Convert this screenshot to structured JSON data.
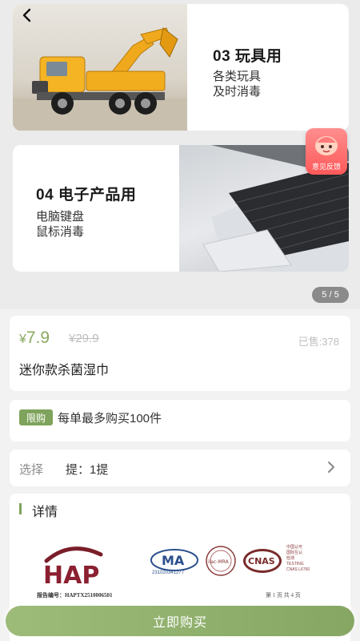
{
  "gallery": {
    "card1": {
      "title": "03 玩具用",
      "lines": [
        "各类玩具",
        "及时消毒"
      ]
    },
    "card2": {
      "title": "04 电子产品用",
      "lines": [
        "电脑键盘",
        "鼠标消毒"
      ]
    },
    "feedback_label": "意见反馈",
    "page_indicator": "5 / 5"
  },
  "product": {
    "currency": "¥",
    "price": "7.9",
    "original_price": "¥29.9",
    "sold": "已售:378",
    "name": "迷你款杀菌湿巾"
  },
  "limit": {
    "tag": "限购",
    "text": "每单最多购买100件"
  },
  "select": {
    "label": "选择",
    "value": "提：1提"
  },
  "detail": {
    "title": "详情",
    "report_number": "报告编号：HAPTX2510006501",
    "ma_number": "231020341277",
    "page_text": "第 1 页 共 4 页",
    "cnas_side": [
      "中国认可",
      "国际互认",
      "检测",
      "TESTING",
      "CNAS L6760"
    ],
    "logos": {
      "hap": "HAP",
      "ma": "MA",
      "ilac": "ilac-MRA",
      "cnas": "CNAS"
    }
  },
  "buy_button": "立即购买",
  "colors": {
    "accent": "#7fa35c",
    "price": "#8aa961",
    "feedback": "#ff6b6b"
  }
}
